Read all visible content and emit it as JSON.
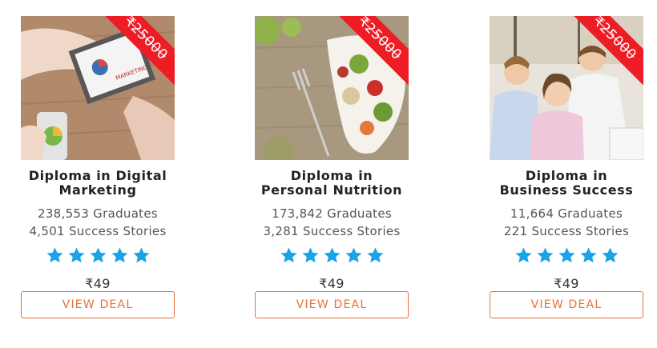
{
  "courses": [
    {
      "ribbon_price": "₹25000",
      "title": "Diploma in Digital Marketing",
      "graduates": "238,553 Graduates",
      "stories": "4,501 Success Stories",
      "rating": 5,
      "price": "₹49",
      "button": "VIEW DEAL",
      "image_text": "MARKETING"
    },
    {
      "ribbon_price": "₹25000",
      "title": "Diploma in Personal Nutrition",
      "graduates": "173,842 Graduates",
      "stories": "3,281 Success Stories",
      "rating": 5,
      "price": "₹49",
      "button": "VIEW DEAL"
    },
    {
      "ribbon_price": "₹25000",
      "title": "Diploma in Business Success",
      "graduates": "11,664 Graduates",
      "stories": "221 Success Stories",
      "rating": 5,
      "price": "₹49",
      "button": "VIEW DEAL"
    }
  ],
  "colors": {
    "ribbon": "#ee1c24",
    "star": "#1aa3e8",
    "button_accent": "#e8703a"
  },
  "icons": {
    "star": "star-icon"
  }
}
